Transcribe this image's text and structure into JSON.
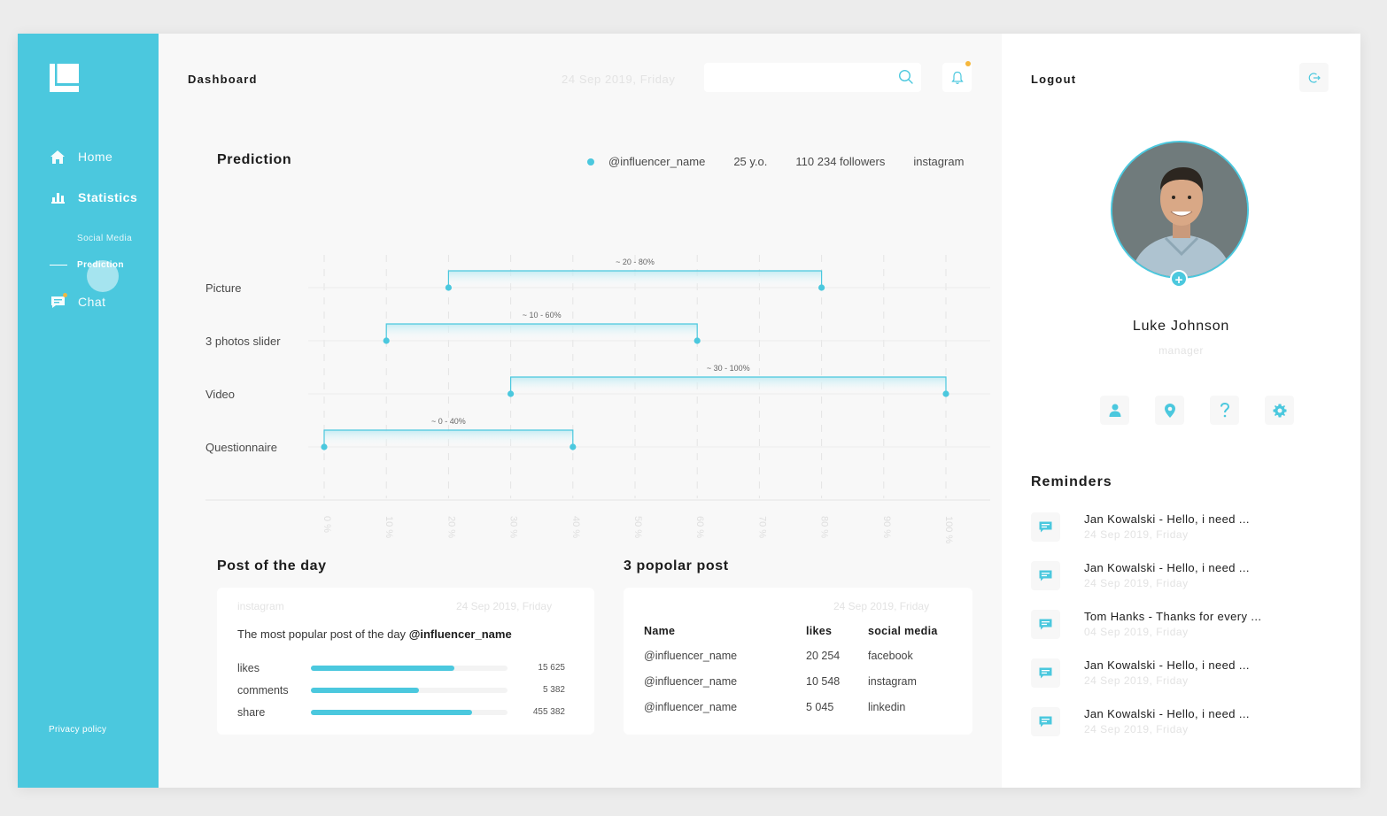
{
  "sidebar": {
    "home_label": "Home",
    "statistics_label": "Statistics",
    "social_media_label": "Social Media",
    "prediction_label": "Prediction",
    "chat_label": "Chat",
    "privacy_label": "Privacy policy"
  },
  "header": {
    "title": "Dashboard",
    "date": "24 Sep 2019, Friday",
    "search_value": "",
    "search_placeholder": ""
  },
  "prediction": {
    "title": "Prediction",
    "handle": "@influencer_name",
    "age": "25 y.o.",
    "followers": "110 234 followers",
    "platform": "instagram"
  },
  "chart_data": {
    "type": "range-bar",
    "categories": [
      "Picture",
      "3 photos slider",
      "Video",
      "Questionnaire"
    ],
    "ranges": [
      [
        20,
        80
      ],
      [
        10,
        60
      ],
      [
        30,
        100
      ],
      [
        0,
        40
      ]
    ],
    "range_labels": [
      "~ 20 - 80%",
      "~ 10 - 60%",
      "~ 30 - 100%",
      "~ 0 - 40%"
    ],
    "x_ticks": [
      "0 %",
      "10 %",
      "20 %",
      "30 %",
      "40 %",
      "50 %",
      "60 %",
      "70 %",
      "80 %",
      "90 %",
      "100 %"
    ],
    "xlim": [
      0,
      100
    ],
    "grid": true
  },
  "post_of_day": {
    "title": "Post of the day",
    "source": "instagram",
    "date": "24 Sep 2019, Friday",
    "desc_prefix": "The most popular post of the day",
    "desc_handle": "@influencer_name",
    "stats": [
      {
        "label": "likes",
        "value": "15 625",
        "fill": 0.73
      },
      {
        "label": "comments",
        "value": "5 382",
        "fill": 0.55
      },
      {
        "label": "share",
        "value": "455 382",
        "fill": 0.82
      }
    ]
  },
  "popular": {
    "title": "3 popolar post",
    "date": "24 Sep 2019, Friday",
    "headers": [
      "Name",
      "likes",
      "social media"
    ],
    "rows": [
      [
        "@influencer_name",
        "20 254",
        "facebook"
      ],
      [
        "@influencer_name",
        "10 548",
        "instagram"
      ],
      [
        "@influencer_name",
        "5 045",
        "linkedin"
      ]
    ]
  },
  "profile": {
    "logout_label": "Logout",
    "name": "Luke Johnson",
    "role": "manager",
    "add_label": "+"
  },
  "reminders": {
    "title": "Reminders",
    "items": [
      {
        "text": "Jan Kowalski - Hello, i need ...",
        "date": "24 Sep 2019, Friday"
      },
      {
        "text": "Jan Kowalski - Hello, i need ...",
        "date": "24 Sep 2019, Friday"
      },
      {
        "text": "Tom Hanks - Thanks for every ...",
        "date": "04 Sep 2019, Friday"
      },
      {
        "text": "Jan Kowalski - Hello, i need ...",
        "date": "24 Sep 2019, Friday"
      },
      {
        "text": "Jan Kowalski - Hello, i need ...",
        "date": "24 Sep 2019, Friday"
      }
    ]
  },
  "colors": {
    "accent": "#4bc8de",
    "notification": "#f6b73c",
    "muted_text": "#e3e3e3"
  }
}
